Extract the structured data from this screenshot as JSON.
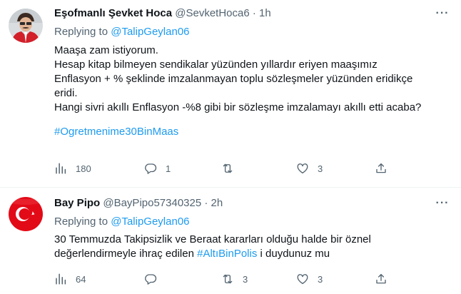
{
  "tweets": [
    {
      "author_name": "Eşofmanlı Şevket Hoca",
      "author_handle": "@SevketHoca6",
      "separator": "·",
      "time": "1h",
      "replying_prefix": "Replying to ",
      "replying_to": "@TalipGeylan06",
      "body_lines": [
        "Maaşa zam istiyorum.",
        "Hesap kitap bilmeyen sendikalar yüzünden yıllardır eriyen maaşımız",
        "Enflasyon + % şeklinde imzalanmayan toplu sözleşmeler yüzünden eridikçe",
        "eridi.",
        "Hangi sivri akıllı Enflasyon -%8 gibi bir sözleşme imzalamayı akıllı etti acaba?"
      ],
      "hashtag": "#Ogretmenime30BinMaas",
      "views_count": "180",
      "reply_count": "1",
      "retweet_count": "",
      "like_count": "3"
    },
    {
      "author_name": "Bay Pipo",
      "author_handle": "@BayPipo57340325",
      "separator": "·",
      "time": "2h",
      "replying_prefix": "Replying to ",
      "replying_to": "@TalipGeylan06",
      "body_line1": "30 Temmuzda Takipsizlik ve Beraat kararları olduğu halde bir öznel",
      "body_line2_before": "değerlendirmeyle ihraç edilen ",
      "body_hashtag": "#AltıBinPolis",
      "body_line2_after": " i duydunuz mu",
      "views_count": "64",
      "reply_count": "",
      "retweet_count": "3",
      "like_count": "3"
    }
  ],
  "icons": {
    "more": "more-horizontal-icon",
    "views": "bar-chart-icon",
    "reply": "speech-bubble-icon",
    "retweet": "retweet-arrows-icon",
    "like": "heart-icon",
    "share": "share-upload-icon"
  },
  "colors": {
    "link": "#1d9bf0",
    "secondary_text": "#536471",
    "primary_text": "#0f1419",
    "divider": "#eff3f4",
    "flag_red": "#e30a17"
  }
}
